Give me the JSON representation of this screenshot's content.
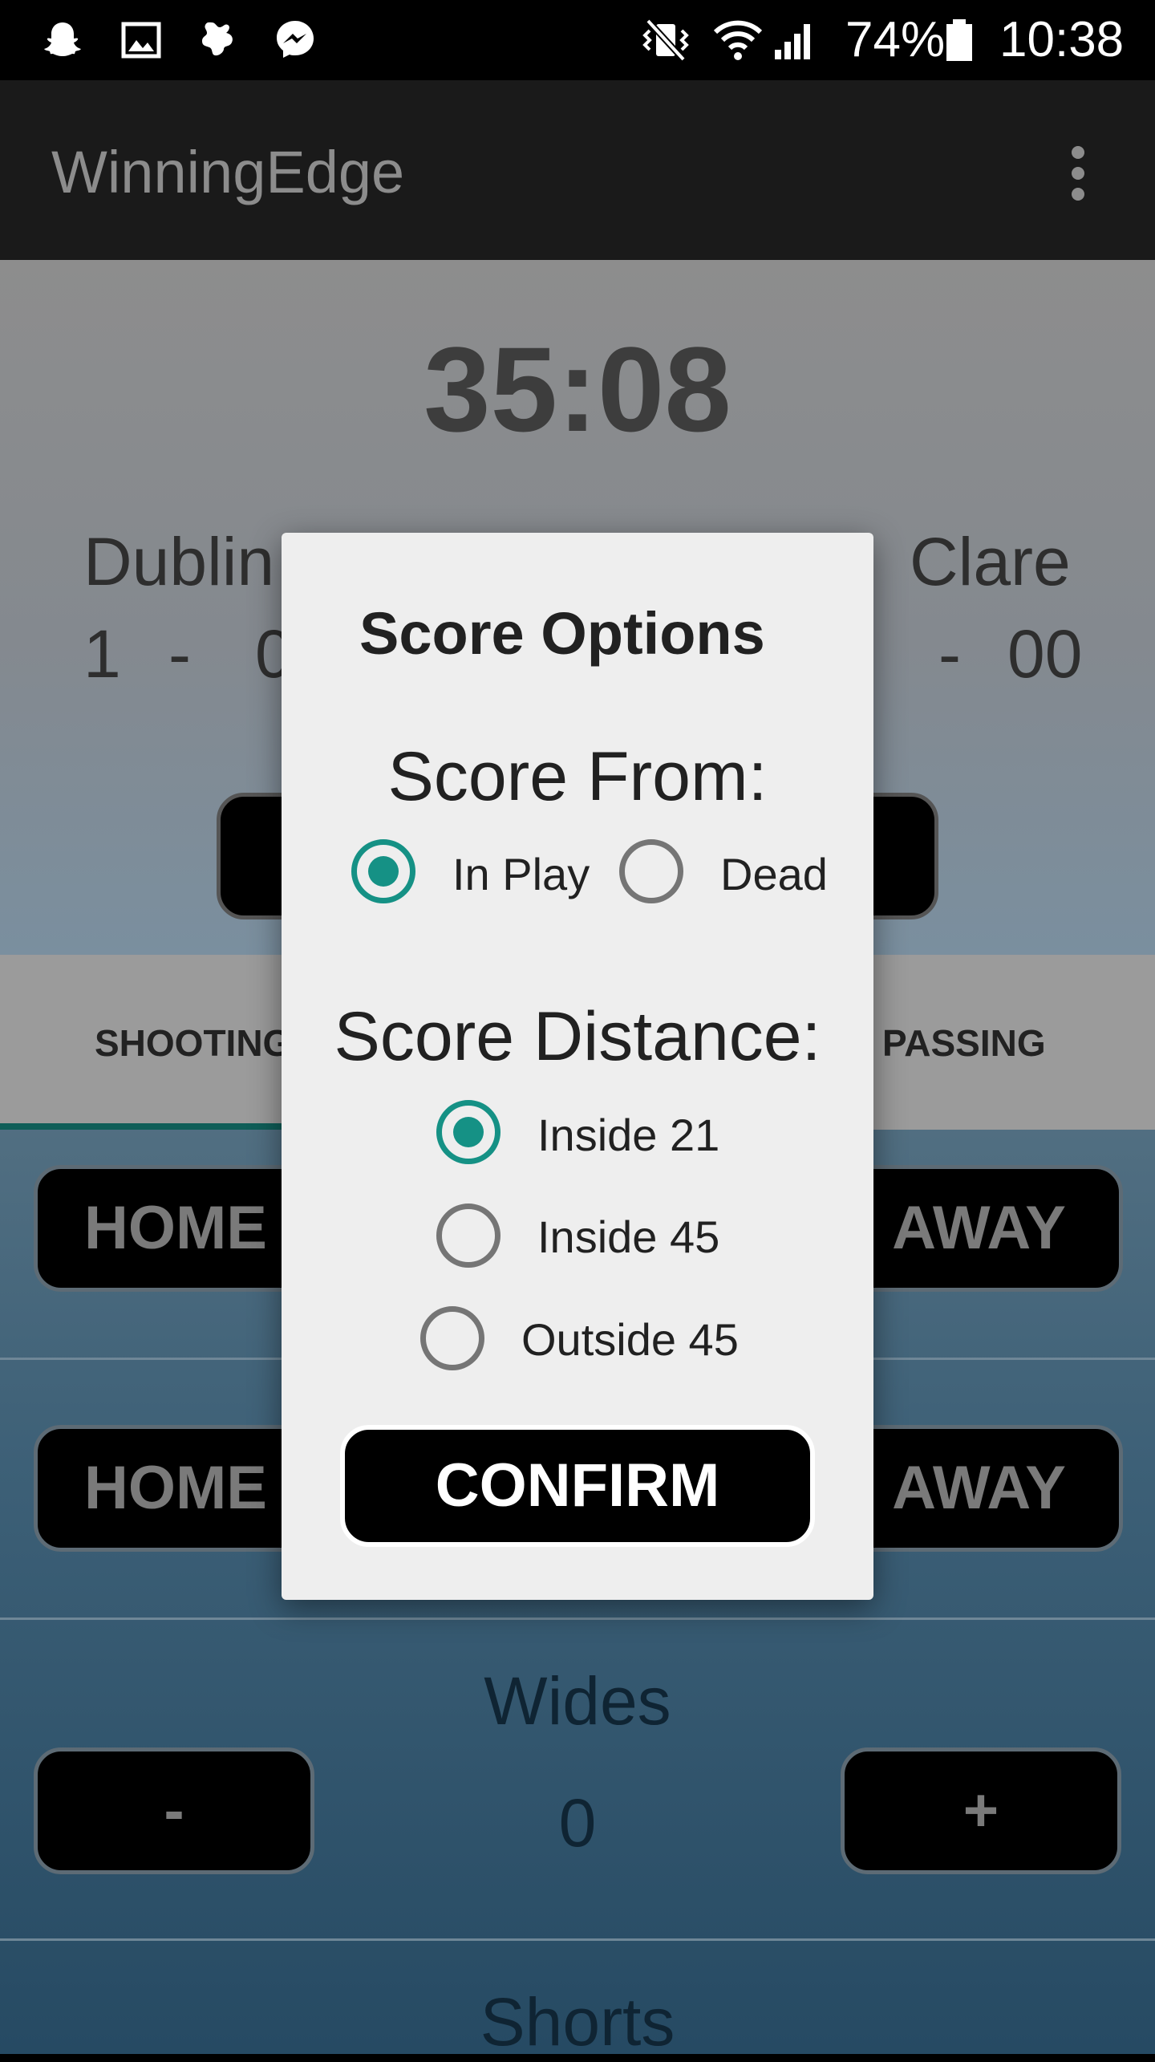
{
  "status_bar": {
    "icons": [
      "snapchat-icon",
      "gallery-icon",
      "app-icon",
      "messenger-icon",
      "vibrate-icon",
      "wifi-icon",
      "signal-icon",
      "battery-icon"
    ],
    "battery": "74%",
    "time": "10:38"
  },
  "app_bar": {
    "title": "WinningEdge",
    "menu_icon": "overflow-menu-icon"
  },
  "match": {
    "timer": "35:08",
    "home_team": "Dublin",
    "away_team": "Clare",
    "home_score_goals": "1",
    "home_score_sep": "-",
    "home_score_points": "0",
    "away_score_sep": "-",
    "away_score_points": "00"
  },
  "tabs": [
    {
      "label": "SHOOTING",
      "selected": true
    },
    {
      "label": "PASSING",
      "selected": false
    }
  ],
  "rows": {
    "row1": {
      "home": "HOME",
      "away": "AWAY"
    },
    "row2": {
      "home": "HOME",
      "away": "AWAY"
    },
    "wides": {
      "label": "Wides",
      "minus": "-",
      "value": "0",
      "plus": "+"
    },
    "shorts": {
      "label": "Shorts"
    }
  },
  "dialog": {
    "title": "Score Options",
    "from_heading": "Score From:",
    "from_options": [
      {
        "label": "In Play",
        "checked": true
      },
      {
        "label": "Dead",
        "checked": false
      }
    ],
    "distance_heading": "Score Distance:",
    "distance_options": [
      {
        "label": "Inside 21",
        "checked": true
      },
      {
        "label": "Inside 45",
        "checked": false
      },
      {
        "label": "Outside 45",
        "checked": false
      }
    ],
    "confirm_label": "CONFIRM"
  },
  "colors": {
    "accent": "#159185",
    "dialog_bg": "#eeeeee",
    "appbar_bg": "#1a1a1a"
  }
}
